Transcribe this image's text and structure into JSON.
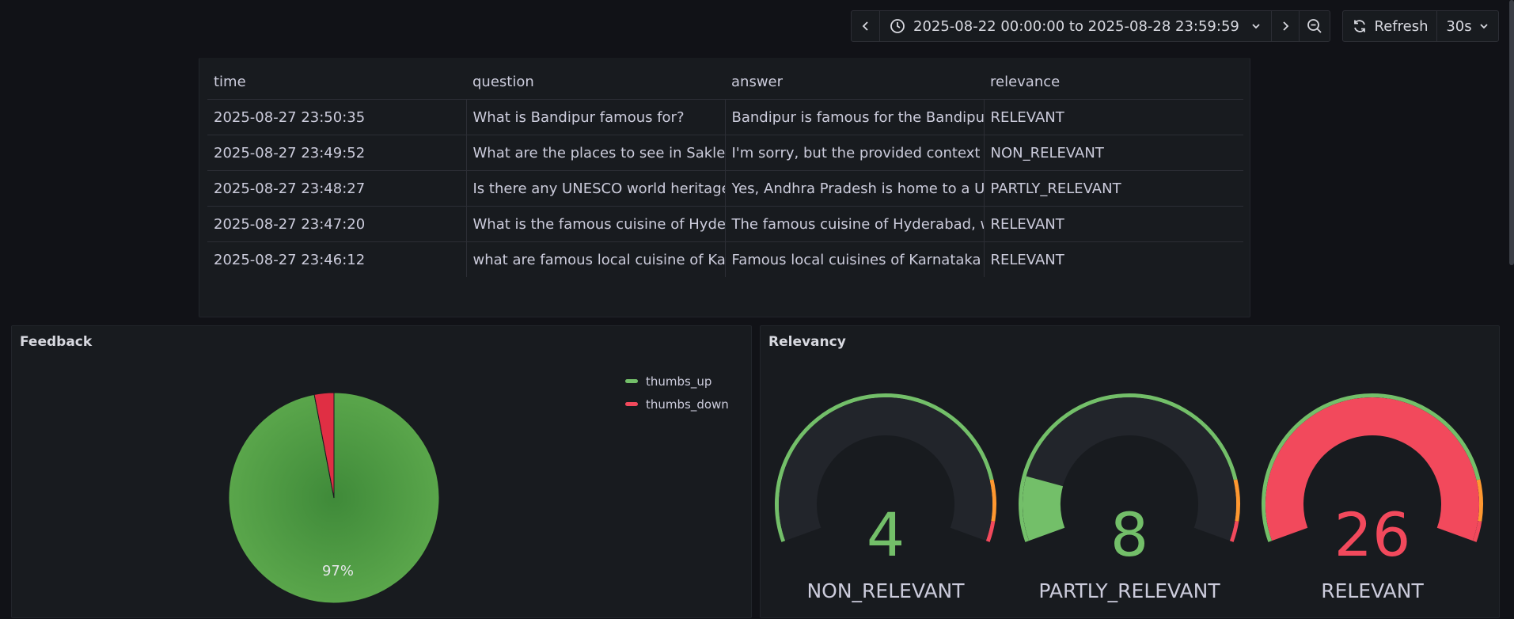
{
  "toolbar": {
    "time_range": "2025-08-22 00:00:00 to 2025-08-28 23:59:59",
    "refresh_label": "Refresh",
    "refresh_interval": "30s"
  },
  "table": {
    "columns": [
      "time",
      "question",
      "answer",
      "relevance"
    ],
    "rows": [
      [
        "2025-08-27 23:50:35",
        "What is Bandipur famous for?",
        "Bandipur is famous for the Bandipur N",
        "RELEVANT"
      ],
      [
        "2025-08-27 23:49:52",
        "What are the places to see in Saklesh",
        "I'm sorry, but the provided context do",
        "NON_RELEVANT"
      ],
      [
        "2025-08-27 23:48:27",
        "Is there any UNESCO world heritage i",
        "Yes, Andhra Pradesh is home to a UNI",
        "PARTLY_RELEVANT"
      ],
      [
        "2025-08-27 23:47:20",
        "What is the famous cuisine of Hyderb",
        "The famous cuisine of Hyderabad, wh",
        "RELEVANT"
      ],
      [
        "2025-08-27 23:46:12",
        "what are famous local cuisine of Karn",
        "Famous local cuisines of Karnataka in",
        "RELEVANT"
      ]
    ]
  },
  "feedback": {
    "title": "Feedback",
    "legend": [
      {
        "label": "thumbs_up",
        "color": "#73bf69"
      },
      {
        "label": "thumbs_down",
        "color": "#f2495c"
      }
    ],
    "percent_label": "97%"
  },
  "relevancy": {
    "title": "Relevancy",
    "gauges": [
      {
        "label": "NON_RELEVANT",
        "value": "4",
        "fraction": 0.0,
        "color": "#73bf69"
      },
      {
        "label": "PARTLY_RELEVANT",
        "value": "8",
        "fraction": 0.16,
        "color": "#73bf69"
      },
      {
        "label": "RELEVANT",
        "value": "26",
        "fraction": 1.0,
        "color": "#f2495c"
      }
    ],
    "threshold_colors": [
      "#73bf69",
      "#ff9830",
      "#f2495c"
    ]
  },
  "chart_data": {
    "type": "pie",
    "title": "Feedback",
    "labels": [
      "thumbs_up",
      "thumbs_down"
    ],
    "values": [
      97,
      3
    ],
    "colors": [
      "#5aa64b",
      "#e02f44"
    ]
  }
}
